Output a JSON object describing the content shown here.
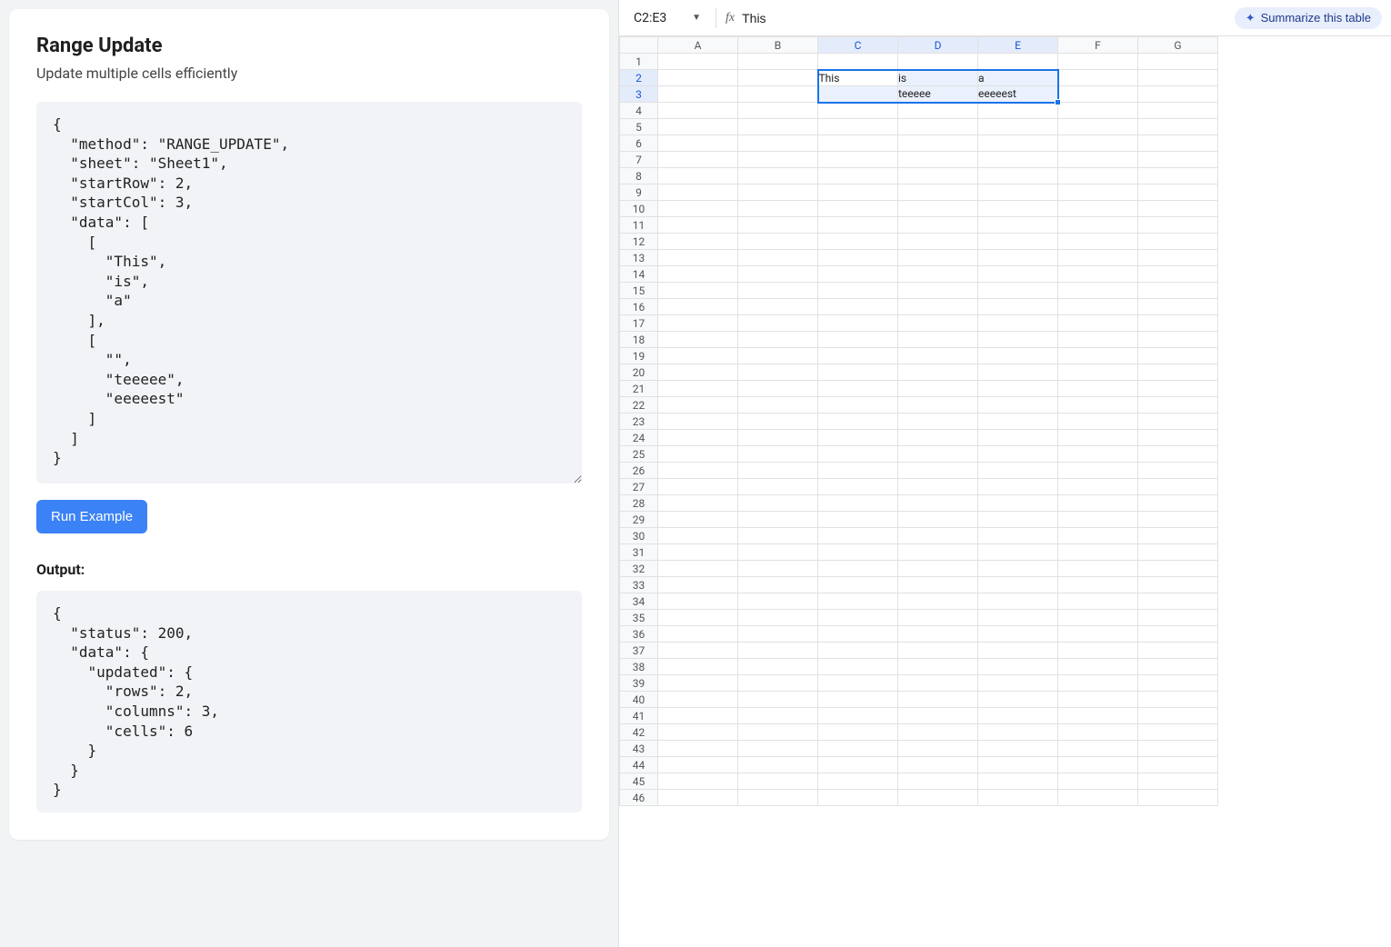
{
  "left": {
    "title": "Range Update",
    "subtitle": "Update multiple cells efficiently",
    "code": "{\n  \"method\": \"RANGE_UPDATE\",\n  \"sheet\": \"Sheet1\",\n  \"startRow\": 2,\n  \"startCol\": 3,\n  \"data\": [\n    [\n      \"This\",\n      \"is\",\n      \"a\"\n    ],\n    [\n      \"\",\n      \"teeeee\",\n      \"eeeeest\"\n    ]\n  ]\n}",
    "run_label": "Run Example",
    "output_label": "Output:",
    "output": "{\n  \"status\": 200,\n  \"data\": {\n    \"updated\": {\n      \"rows\": 2,\n      \"columns\": 3,\n      \"cells\": 6\n    }\n  }\n}"
  },
  "sheet": {
    "name_box": "C2:E3",
    "formula_value": "This",
    "summarize_label": "Summarize this table",
    "columns": [
      "A",
      "B",
      "C",
      "D",
      "E",
      "F",
      "G"
    ],
    "col_widths": {
      "A": 88,
      "B": 88,
      "C": 88,
      "D": 88,
      "E": 88,
      "F": 88,
      "G": 60
    },
    "row_count": 46,
    "selected_cols": [
      "C",
      "D",
      "E"
    ],
    "selected_rows": [
      2,
      3
    ],
    "selection": {
      "from": {
        "row": 2,
        "col": "C"
      },
      "to": {
        "row": 3,
        "col": "E"
      }
    },
    "active_cell": {
      "row": 2,
      "col": "C"
    },
    "cells": {
      "C2": "This",
      "D2": "is",
      "E2": "a",
      "C3": "",
      "D3": "teeeee",
      "E3": "eeeeest"
    }
  }
}
